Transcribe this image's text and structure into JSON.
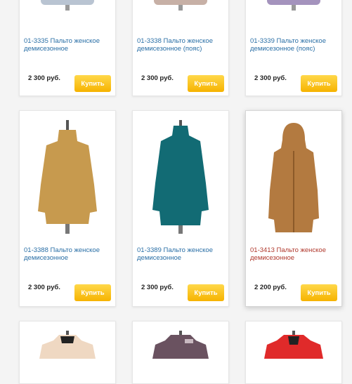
{
  "products": [
    {
      "title": "01-3335 Пальто женское демисезонное",
      "price": "2 300 руб.",
      "buy_label": "Купить",
      "coat_color": "#b9c4d2"
    },
    {
      "title": "01-3338 Пальто женское демисезонное (пояс)",
      "price": "2 300 руб.",
      "buy_label": "Купить",
      "coat_color": "#c7b0a6"
    },
    {
      "title": "01-3339 Пальто женское демисезонное (пояс)",
      "price": "2 300 руб.",
      "buy_label": "Купить",
      "coat_color": "#a493bd"
    },
    {
      "title": "01-3388 Пальто женское демисезонное",
      "price": "2 300 руб.",
      "buy_label": "Купить",
      "coat_color": "#c79a4e"
    },
    {
      "title": "01-3389 Пальто женское демисезонное",
      "price": "2 300 руб.",
      "buy_label": "Купить",
      "coat_color": "#126b74"
    },
    {
      "title": "01-3413 Пальто женское демисезонное",
      "price": "2 200 руб.",
      "buy_label": "Купить",
      "coat_color": "#b37a40"
    },
    {
      "coat_color": "#efd8c2"
    },
    {
      "coat_color": "#6a5260"
    },
    {
      "coat_color": "#e02a2a"
    }
  ]
}
